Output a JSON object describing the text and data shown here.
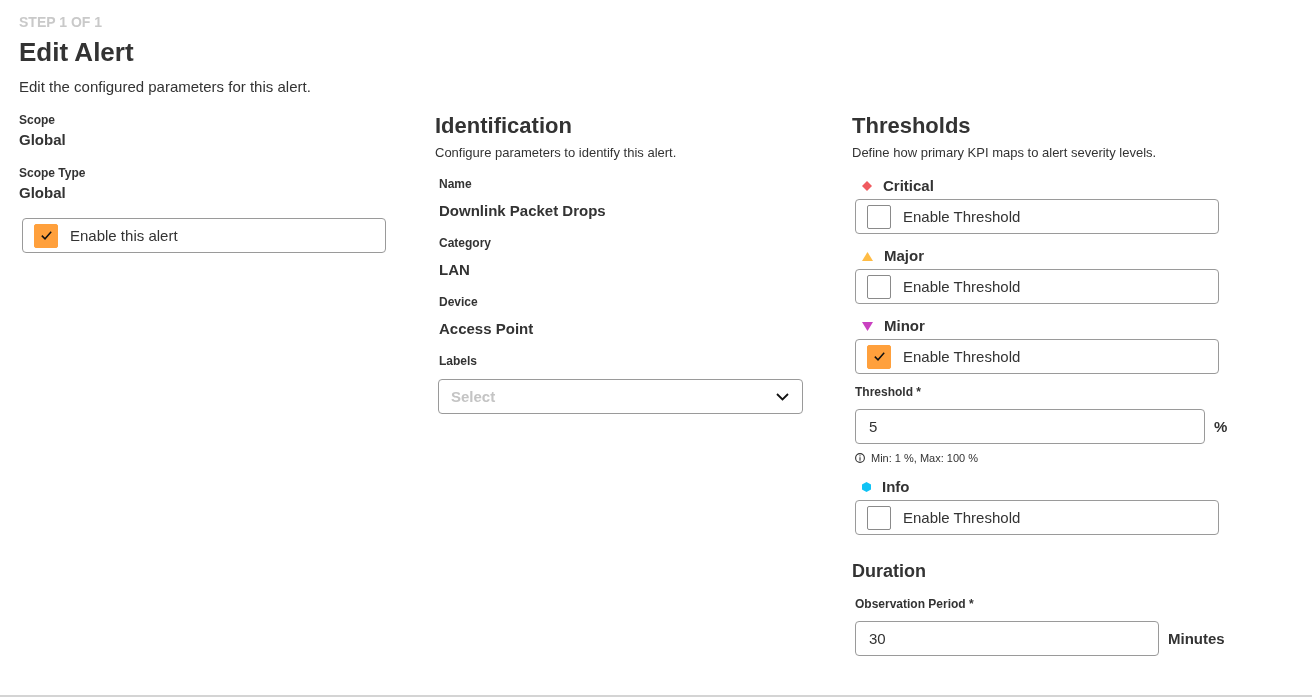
{
  "step": "STEP 1 OF 1",
  "title": "Edit Alert",
  "description": "Edit the configured parameters for this alert.",
  "scope": {
    "fields": [
      {
        "label": "Scope",
        "value": "Global"
      },
      {
        "label": "Scope Type",
        "value": "Global"
      }
    ],
    "enable": {
      "label": "Enable this alert",
      "checked": true
    }
  },
  "identification": {
    "heading": "Identification",
    "description": "Configure parameters to identify this alert.",
    "fields": [
      {
        "label": "Name",
        "value": "Downlink Packet Drops"
      },
      {
        "label": "Category",
        "value": "LAN"
      },
      {
        "label": "Device",
        "value": "Access Point"
      }
    ],
    "labels": {
      "label": "Labels",
      "placeholder": "Select"
    }
  },
  "thresholds": {
    "heading": "Thresholds",
    "description": "Define how primary KPI maps to alert severity levels.",
    "levels": [
      {
        "kind": "critical",
        "name": "Critical",
        "color": "#f05a5f",
        "enable": {
          "label": "Enable Threshold",
          "checked": false
        }
      },
      {
        "kind": "major",
        "name": "Major",
        "color": "#ffbc45",
        "enable": {
          "label": "Enable Threshold",
          "checked": false
        }
      },
      {
        "kind": "minor",
        "name": "Minor",
        "color": "#c941c0",
        "enable": {
          "label": "Enable Threshold",
          "checked": true
        },
        "threshold": {
          "label": "Threshold *",
          "value": "5",
          "unit": "%",
          "hint": "Min: 1 %, Max: 100 %"
        }
      },
      {
        "kind": "info",
        "name": "Info",
        "color": "#10c3f5",
        "enable": {
          "label": "Enable Threshold",
          "checked": false
        }
      }
    ]
  },
  "duration": {
    "heading": "Duration",
    "field": {
      "label": "Observation Period *",
      "value": "30",
      "unit": "Minutes"
    }
  }
}
